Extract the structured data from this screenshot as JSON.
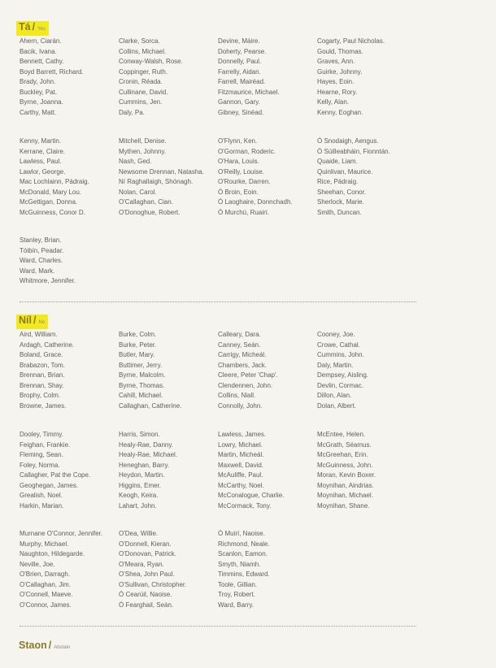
{
  "sections": {
    "ta": {
      "label": "Tá",
      "sublabel": "Yes"
    },
    "nil": {
      "label": "Níl",
      "sublabel": "No"
    },
    "staon": {
      "label": "Staon",
      "sublabel": "Abstain"
    }
  },
  "ta_blocks": [
    [
      [
        "Ahern, Ciarán.",
        "Bacik, Ivana.",
        "Bennett, Cathy.",
        "Boyd Barrett, Richard.",
        "Brady, John.",
        "Buckley, Pat.",
        "Byrne, Joanna.",
        "Carthy, Matt."
      ],
      [
        "Clarke, Sorca.",
        "Collins, Michael.",
        "Conway-Walsh, Rose.",
        "Coppinger, Ruth.",
        "Cronin, Réada.",
        "Cullinane, David.",
        "Cummins, Jen.",
        "Daly, Pa."
      ],
      [
        "Devine, Máire.",
        "Doherty, Pearse.",
        "Donnelly, Paul.",
        "Farrelly, Aidan.",
        "Farrell, Mairéad.",
        "Fitzmaurice, Michael.",
        "Gannon, Gary.",
        "Gibney, Sinéad."
      ],
      [
        "Cogarty, Paul Nicholas.",
        "Gould, Thomas.",
        "Graves, Ann.",
        "Guirke, Johnny.",
        "Hayes, Eoin.",
        "Hearne, Rory.",
        "Kelly, Alan.",
        "Kenny, Eoghan."
      ]
    ],
    [
      [
        "Kenny, Martin.",
        "Kerrane, Claire.",
        "Lawless, Paul.",
        "Lawlor, George.",
        "Mac Lochlainn, Pádraig.",
        "McDonald, Mary Lou.",
        "McGettigan, Donna.",
        "McGuinness, Conor D."
      ],
      [
        "Mitchell, Denise.",
        "Mythen, Johnny.",
        "Nash, Ged.",
        "Newsome Drennan, Natasha.",
        "Ní Raghallaigh, Shónagh.",
        "Nolan, Carol.",
        "O'Callaghan, Cian.",
        "O'Donoghue, Robert."
      ],
      [
        "O'Flynn, Ken.",
        "O'Gorman, Roderic.",
        "O'Hara, Louis.",
        "O'Reilly, Louise.",
        "O'Rourke, Darren.",
        "Ó Broin, Eoin.",
        "Ó Laoghaire, Donnchadh.",
        "Ó Murchú, Ruairí."
      ],
      [
        "Ó Snodaigh, Aengus.",
        "Ó Súilleabháin, Fionntán.",
        "Quaide, Liam.",
        "Quinlivan, Maurice.",
        "Rice, Pádraig.",
        "Sheehan, Conor.",
        "Sherlock, Marie.",
        "Smith, Duncan."
      ]
    ],
    [
      [
        "Stanley, Brian.",
        "Tóibín, Peadar.",
        "Ward, Charles.",
        "Ward, Mark.",
        "Whitmore, Jennifer."
      ],
      [],
      [],
      []
    ]
  ],
  "nil_blocks": [
    [
      [
        "Aird, William.",
        "Ardagh, Catherine.",
        "Boland, Grace.",
        "Brabazon, Tom.",
        "Brennan, Brian.",
        "Brennan, Shay.",
        "Brophy, Colm.",
        "Browne, James."
      ],
      [
        "Burke, Colm.",
        "Burke, Peter.",
        "Butler, Mary.",
        "Buttimer, Jerry.",
        "Byrne, Malcolm.",
        "Byrne, Thomas.",
        "Cahill, Michael.",
        "Callaghan, Catherine."
      ],
      [
        "Calleary, Dara.",
        "Canney, Seán.",
        "Carrigy, Micheál.",
        "Chambers, Jack.",
        "Cleere, Peter 'Chap'.",
        "Clendennen, John.",
        "Collins, Niall.",
        "Connolly, John."
      ],
      [
        "Cooney, Joe.",
        "Crowe, Cathal.",
        "Cummins, John.",
        "Daly, Martin.",
        "Dempsey, Aisling.",
        "Devlin, Cormac.",
        "Dillon, Alan.",
        "Dolan, Albert."
      ]
    ],
    [
      [
        "Dooley, Timmy.",
        "Feighan, Frankie.",
        "Fleming, Sean.",
        "Foley, Norma.",
        "Callagher, Pat the Cope.",
        "Geoghegan, James.",
        "Grealish, Noel.",
        "Harkin, Marian."
      ],
      [
        "Harris, Simon.",
        "Healy-Rae, Danny.",
        "Healy-Rae, Michael.",
        "Heneghan, Barry.",
        "Heydon, Martin.",
        "Higgins, Emer.",
        "Keogh, Keira.",
        "Lahart, John."
      ],
      [
        "Lawless, James.",
        "Lowry, Michael.",
        "Martin, Micheál.",
        "Maxwell, David.",
        "McAuliffe, Paul.",
        "McCarthy, Noel.",
        "McConalogue, Charlie.",
        "McCormack, Tony."
      ],
      [
        "McEntee, Helen.",
        "McGrath, Séamus.",
        "McGreehan, Erin.",
        "McGuinness, John.",
        "Moran, Kevin Boxer.",
        "Moynihan, Aindrias.",
        "Moynihan, Michael.",
        "Moynihan, Shane."
      ]
    ],
    [
      [
        "Murnane O'Connor, Jennifer.",
        "Murphy, Michael.",
        "Naughton, Hildegarde.",
        "Neville, Joe.",
        "O'Brien, Darragh.",
        "O'Callaghan, Jim.",
        "O'Connell, Maeve.",
        "O'Connor, James."
      ],
      [
        "O'Dea, Willie.",
        "O'Donnell, Kieran.",
        "O'Donovan, Patrick.",
        "O'Meara, Ryan.",
        "O'Shea, John Paul.",
        "O'Sullivan, Christopher.",
        "Ó Cearúil, Naoise.",
        "Ó Fearghail, Seán."
      ],
      [
        "Ó Muirí, Naoise.",
        "Richmond, Neale.",
        "Scanlon, Eamon.",
        "Smyth, Niamh.",
        "Timmins, Edward.",
        "Toole, Gillian.",
        "Troy, Robert.",
        "Ward, Barry."
      ],
      []
    ]
  ]
}
